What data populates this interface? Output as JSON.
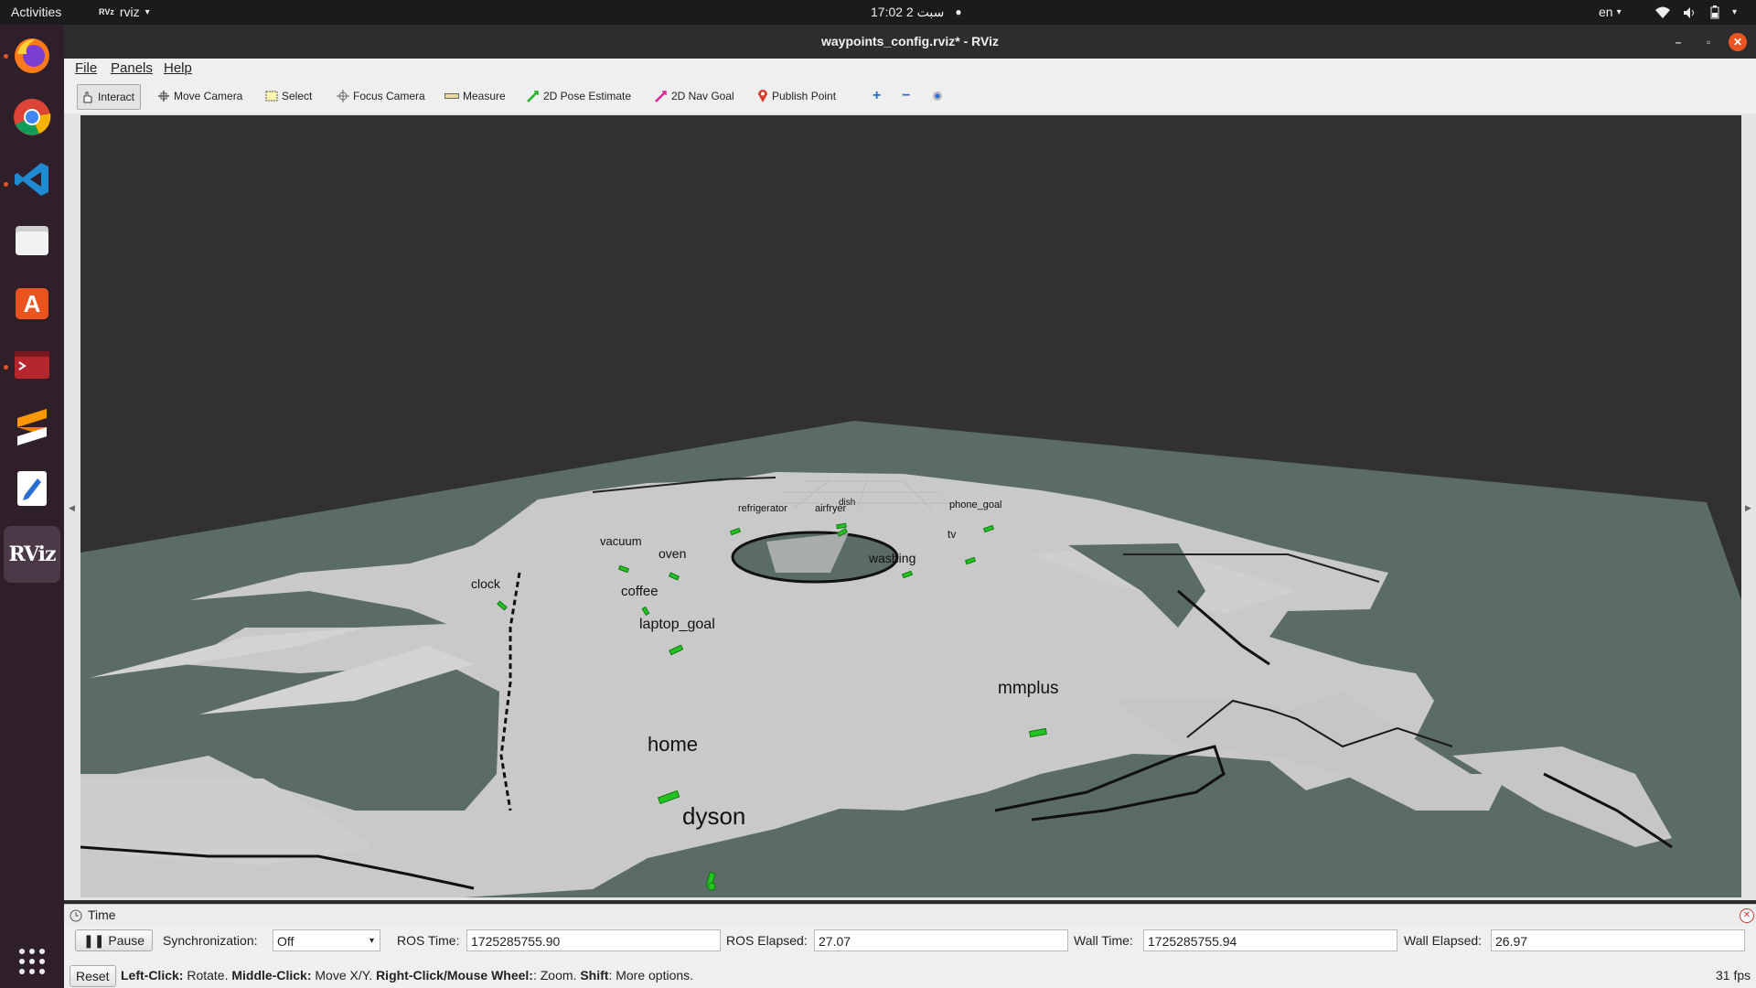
{
  "topbar": {
    "activities": "Activities",
    "app_menu": "rviz",
    "clock": "17:02  2 سبت",
    "language": "en"
  },
  "dock": {
    "apps": [
      "firefox-icon",
      "chrome-icon",
      "vscode-icon",
      "files-icon",
      "software-icon",
      "terminal-icon",
      "sublime-icon",
      "text-editor-icon",
      "rviz-icon"
    ],
    "rviz_label": "RViz",
    "grid_icon": "show-apps-icon"
  },
  "window": {
    "title": "waypoints_config.rviz* - RViz"
  },
  "menu": {
    "file": "File",
    "panels": "Panels",
    "help": "Help"
  },
  "toolbar": {
    "interact": "Interact",
    "move_camera": "Move Camera",
    "select": "Select",
    "focus_camera": "Focus Camera",
    "measure": "Measure",
    "pose_estimate": "2D Pose Estimate",
    "nav_goal": "2D Nav Goal",
    "publish_point": "Publish Point"
  },
  "waypoints": {
    "refrigerator": "refrigerator",
    "airfryer": "airfryer",
    "dish": "dish",
    "phone_goal": "phone_goal",
    "tv": "tv",
    "vacuum": "vacuum",
    "oven": "oven",
    "washing": "washing",
    "clock": "clock",
    "coffee": "coffee",
    "laptop_goal": "laptop_goal",
    "mmplus": "mmplus",
    "home": "home",
    "dyson": "dyson"
  },
  "time_panel": {
    "title": "Time",
    "pause": "Pause",
    "sync_label": "Synchronization:",
    "sync_value": "Off",
    "ros_time_label": "ROS Time:",
    "ros_time": "1725285755.90",
    "ros_elapsed_label": "ROS Elapsed:",
    "ros_elapsed": "27.07",
    "wall_time_label": "Wall Time:",
    "wall_time": "1725285755.94",
    "wall_elapsed_label": "Wall Elapsed:",
    "wall_elapsed": "26.97"
  },
  "status": {
    "reset": "Reset",
    "left_click": "Left-Click:",
    "left_click_desc": " Rotate. ",
    "middle_click": "Middle-Click:",
    "middle_click_desc": " Move X/Y. ",
    "right_click": "Right-Click/Mouse Wheel:",
    "right_click_desc": ": Zoom. ",
    "shift": "Shift",
    "shift_desc": ": More options.",
    "fps": "31 fps"
  },
  "colors": {
    "floor": "#5b6b68",
    "map_free": "#c9c9c9",
    "background": "#313131",
    "waypoint_arrow": "#22c422"
  }
}
